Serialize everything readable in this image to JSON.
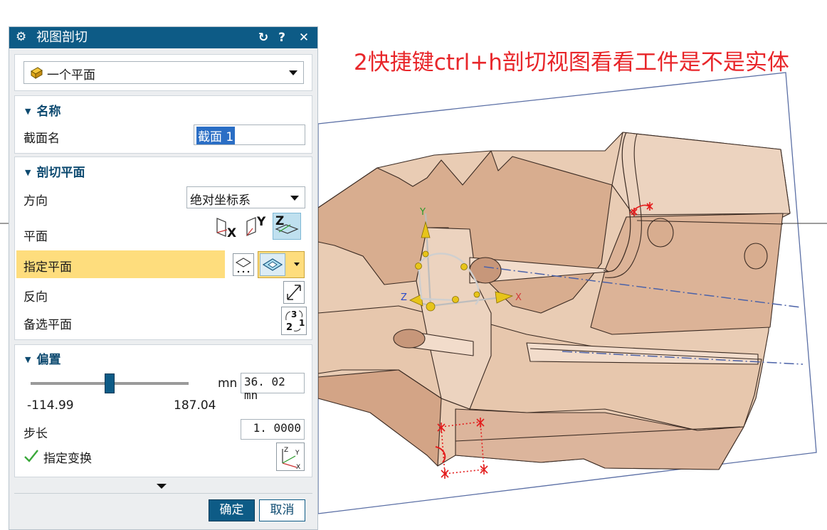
{
  "annotation": {
    "text": "2快捷键ctrl+h剖切视图看看工件是不是实体",
    "color": "#e8262a"
  },
  "dialog": {
    "title": "视图剖切",
    "icons": {
      "title": "gear-icon",
      "reset": "reset-icon",
      "help": "help-icon",
      "close": "close-icon"
    },
    "help_label": "?",
    "close_label": "✕",
    "reset_label": "↻",
    "type_select": {
      "value": "一个平面",
      "icon": "section-type-icon"
    },
    "name_section": {
      "heading": "名称",
      "field_label": "截面名",
      "field_value": "截面 1"
    },
    "plane_section": {
      "heading": "剖切平面",
      "direction_label": "方向",
      "direction_value": "绝对坐标系",
      "plane_label": "平面",
      "plane_buttons": [
        {
          "axis": "X",
          "icon": "plane-x-icon"
        },
        {
          "axis": "Y",
          "icon": "plane-y-icon"
        },
        {
          "axis": "Z",
          "icon": "plane-z-icon",
          "selected": true
        }
      ],
      "specify_plane_label": "指定平面",
      "reverse_label": "反向",
      "alternate_label": "备选平面",
      "alternate_icon_text": [
        "3",
        "2",
        "1"
      ]
    },
    "offset_section": {
      "heading": "偏置",
      "unit": "mn",
      "value": "36. 02 mn",
      "min": "-114.99",
      "max": "187.04",
      "slider_fraction": 0.5,
      "step_label": "步长",
      "step_value": "1. 0000",
      "transform_label": "指定变换",
      "transform_axes": [
        "Z",
        "Y",
        "X"
      ]
    },
    "ok_label": "确定",
    "cancel_label": "取消",
    "accent_color": "#0d5b86",
    "highlight_color": "#fedd7d"
  },
  "triad": {
    "labels": [
      "Y",
      "Z",
      "X"
    ],
    "colors": {
      "y": "#2a9a2a",
      "z": "#2a4ac8",
      "x": "#d23a3a"
    }
  },
  "model": {
    "fill_color": "#eacdb6"
  }
}
